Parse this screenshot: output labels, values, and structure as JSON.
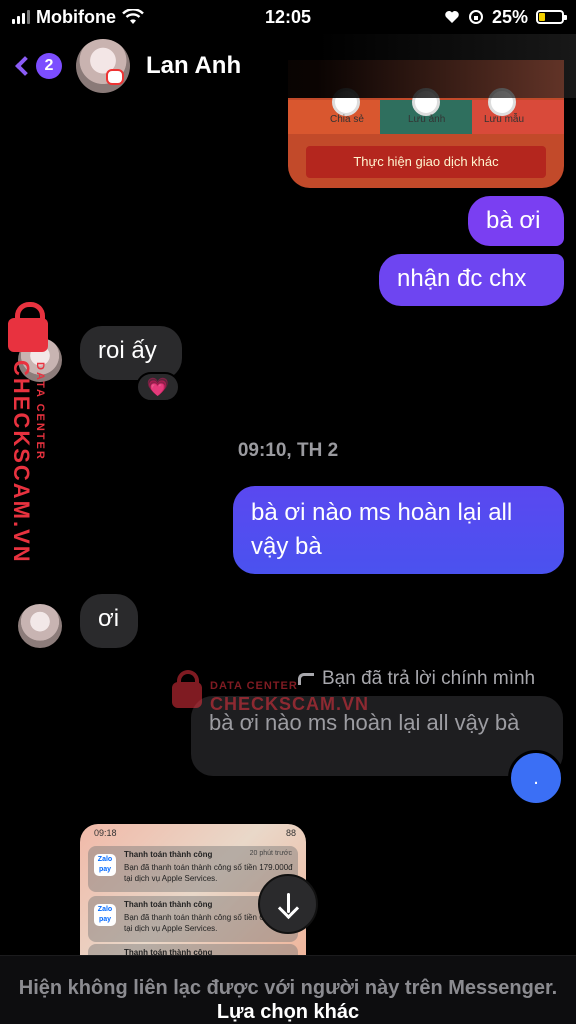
{
  "status": {
    "carrier": "Mobifone",
    "time": "12:05",
    "battery": "25%"
  },
  "header": {
    "back_count": "2",
    "contact_name": "Lan Anh"
  },
  "top_card": {
    "labels": [
      "Chia sẻ",
      "Lưu ảnh",
      "Lưu mẫu"
    ],
    "button": "Thực hiện giao dịch khác"
  },
  "messages": {
    "m1": "bà ơi",
    "m2": "nhận đc chx",
    "m3": "roi ấy",
    "m3_reaction": "💗",
    "timestamp": "09:10, TH 2",
    "m4": "bà ơi nào ms hoàn lại all vậy bà",
    "m5": "ơi",
    "reply_note": "Bạn đã trả lời chính mình",
    "replied_text": "bà ơi nào ms hoàn lại all vậy bà",
    "reply_text": "."
  },
  "screenshot": {
    "time": "09:18",
    "battery": "88",
    "notifications": [
      {
        "title": "Thanh toán thành công",
        "time": "20 phút trước",
        "body": "Bạn đã thanh toán thành công số tiền 179.000đ tại dịch vụ Apple Services."
      },
      {
        "title": "Thanh toán thành công",
        "time": "54",
        "body": "Bạn đã thanh toán thành công số tiền 679.000đ tại dịch vụ Apple Services."
      },
      {
        "title": "Thanh toán thành công",
        "time": "",
        "body": ""
      }
    ],
    "logo": "Zalo pay"
  },
  "bottom": {
    "text": "Hiện không liên lạc được với người này trên Messenger.",
    "link": "Lựa chọn khác"
  },
  "watermark": {
    "brand": "CHECKSCAM.VN",
    "sub": "DATA CENTER"
  },
  "colors": {
    "accent": "#7c4dff",
    "bubble_me_top": "#7b3ff2",
    "bubble_me_bottom": "#4b52ef",
    "bubble_them": "#2a2a2c",
    "watermark": "#e8323f"
  }
}
